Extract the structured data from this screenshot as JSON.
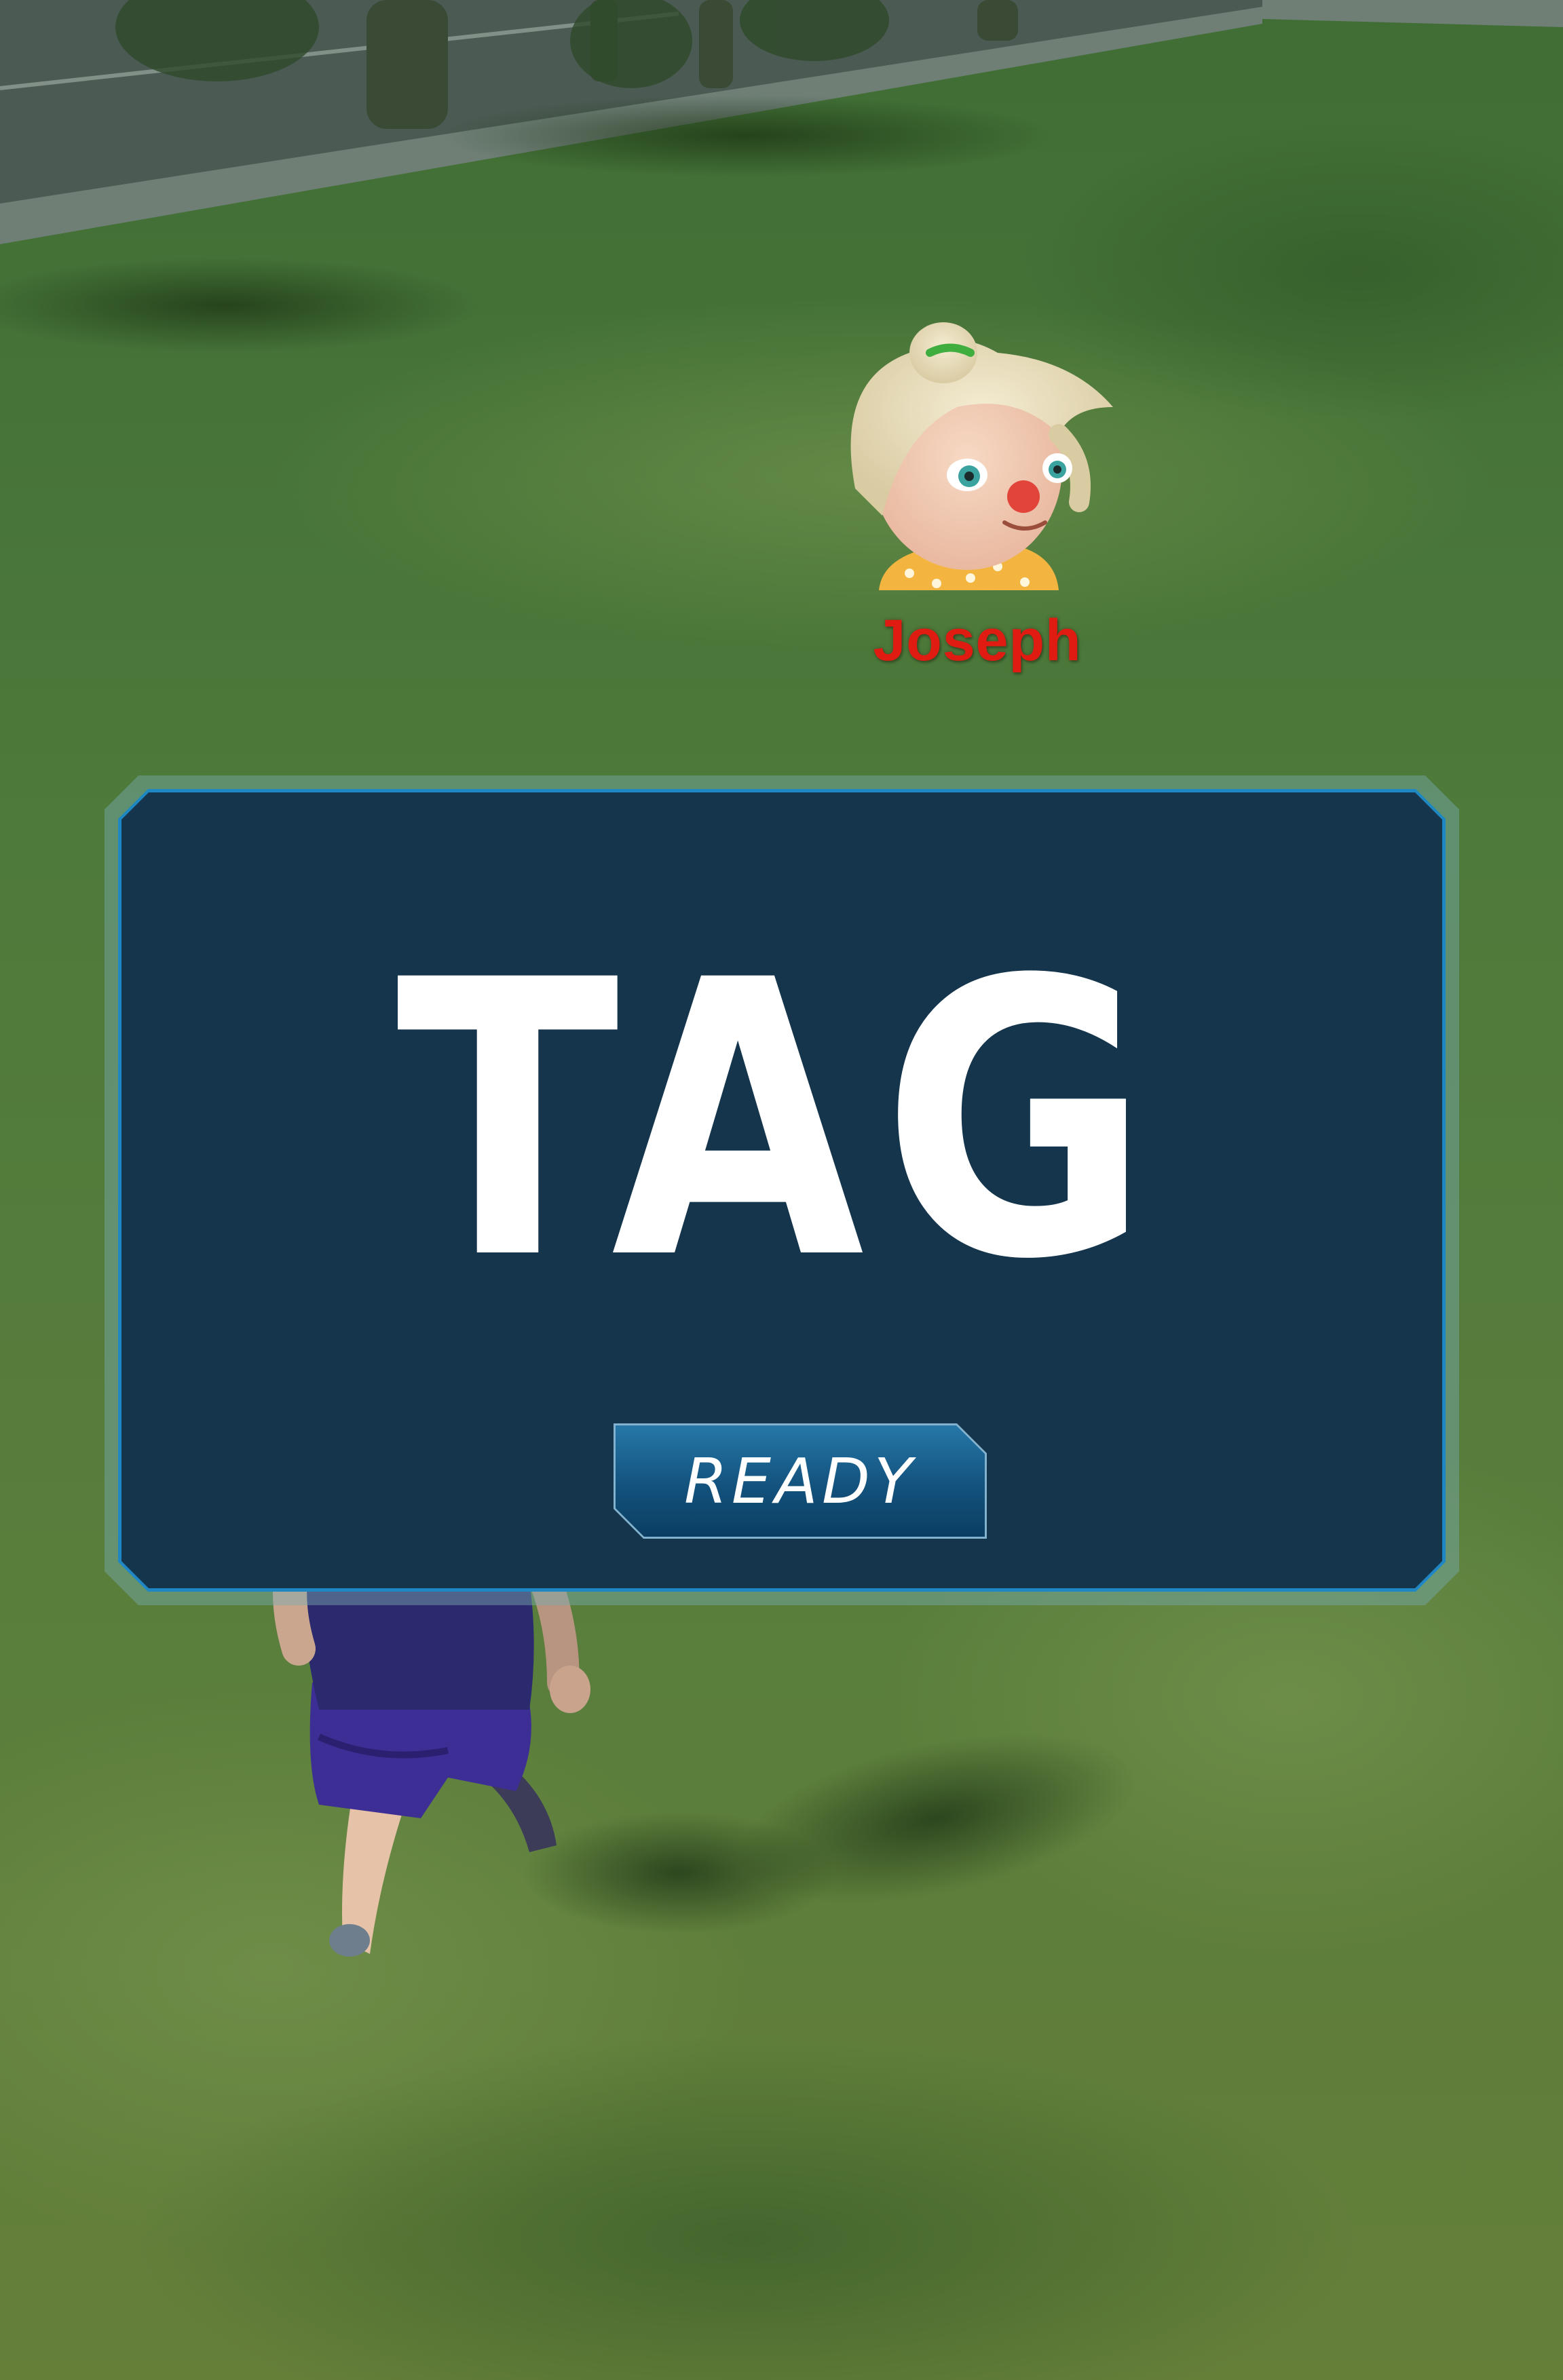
{
  "scene": {
    "npc": {
      "name": "Joseph",
      "name_color": "#e01b12",
      "avatar": "blonde-girl-red-nose-avatar"
    },
    "player_character": "dark-haired-child-purple-outfit"
  },
  "mode_panel": {
    "title": "TAG",
    "ready_label": "READY",
    "border_color": "#1f88c4",
    "button_color": "#13527d"
  }
}
